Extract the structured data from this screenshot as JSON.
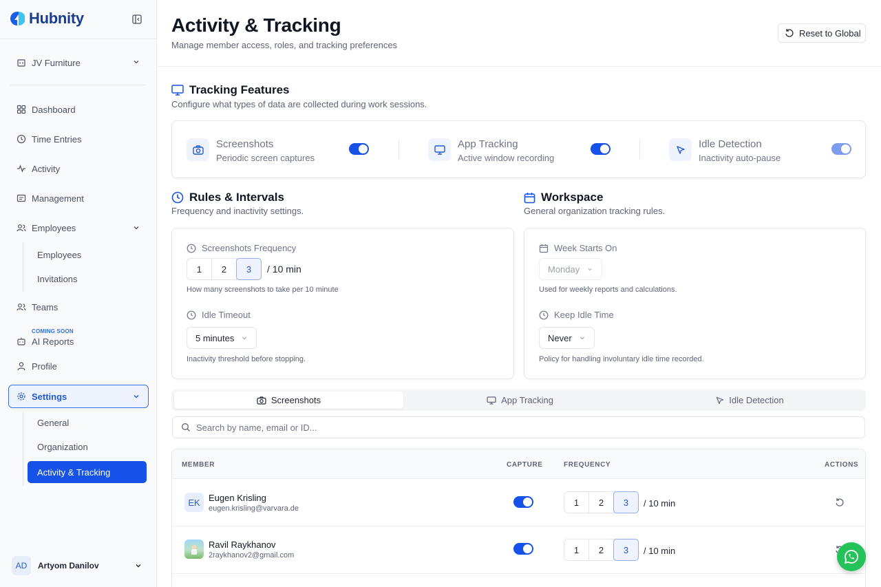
{
  "app": {
    "brand": "Hubnity",
    "brand_color": "#1a3c8f",
    "accent": "#1652e8"
  },
  "sidebar": {
    "org": "JV Furniture",
    "items": [
      {
        "label": "Dashboard",
        "icon": "grid-icon"
      },
      {
        "label": "Time Entries",
        "icon": "history-icon"
      },
      {
        "label": "Activity",
        "icon": "pulse-icon"
      },
      {
        "label": "Management",
        "icon": "folder-icon"
      },
      {
        "label": "Employees",
        "icon": "users-icon"
      },
      {
        "label": "Teams",
        "icon": "team-icon"
      },
      {
        "label": "AI Reports",
        "icon": "bot-icon",
        "badge": "COMING SOON"
      },
      {
        "label": "Profile",
        "icon": "user-icon"
      },
      {
        "label": "Settings",
        "icon": "gear-icon"
      }
    ],
    "employees_sub": [
      "Employees",
      "Invitations"
    ],
    "settings_sub": [
      "General",
      "Organization",
      "Activity & Tracking"
    ],
    "user": {
      "initials": "AD",
      "name": "Artyom Danilov"
    }
  },
  "header": {
    "title": "Activity & Tracking",
    "subtitle": "Manage member access, roles, and tracking preferences",
    "reset_label": "Reset to Global"
  },
  "features": {
    "title": "Tracking Features",
    "subtitle": "Configure what types of data are collected during work sessions.",
    "items": [
      {
        "name": "Screenshots",
        "desc": "Periodic screen captures",
        "enabled": true
      },
      {
        "name": "App Tracking",
        "desc": "Active window recording",
        "enabled": true
      },
      {
        "name": "Idle Detection",
        "desc": "Inactivity auto-pause",
        "enabled": true
      }
    ]
  },
  "rules": {
    "title": "Rules & Intervals",
    "subtitle": "Frequency and inactivity settings.",
    "freq_label": "Screenshots Frequency",
    "freq_options": [
      "1",
      "2",
      "3"
    ],
    "freq_selected": "3",
    "freq_suffix": "/  10 min",
    "freq_help": "How many screenshots to take per 10 minute",
    "idle_label": "Idle Timeout",
    "idle_value": "5 minutes",
    "idle_help": "Inactivity threshold before stopping."
  },
  "workspace": {
    "title": "Workspace",
    "subtitle": "General organization tracking rules.",
    "week_label": "Week Starts On",
    "week_value": "Monday",
    "week_help": "Used for weekly reports and calculations.",
    "keep_label": "Keep Idle Time",
    "keep_value": "Never",
    "keep_help": "Policy for handling involuntary idle time recorded."
  },
  "tabs": [
    "Screenshots",
    "App Tracking",
    "Idle Detection"
  ],
  "search": {
    "placeholder": "Search by name, email or ID..."
  },
  "table": {
    "headers": {
      "member": "MEMBER",
      "capture": "CAPTURE",
      "frequency": "FREQUENCY",
      "actions": "ACTIONS"
    },
    "rows": [
      {
        "initials": "EK",
        "name": "Eugen Krisling",
        "email": "eugen.krisling@varvara.de",
        "capture": true,
        "freq_options": [
          "1",
          "2",
          "3"
        ],
        "freq_selected": "3",
        "suffix": "/  10 min"
      },
      {
        "initials": "",
        "name": "Ravil Raykhanov",
        "email": "2raykhanov2@gmail.com",
        "capture": true,
        "freq_options": [
          "1",
          "2",
          "3"
        ],
        "freq_selected": "3",
        "suffix": "/  10 min"
      }
    ]
  }
}
